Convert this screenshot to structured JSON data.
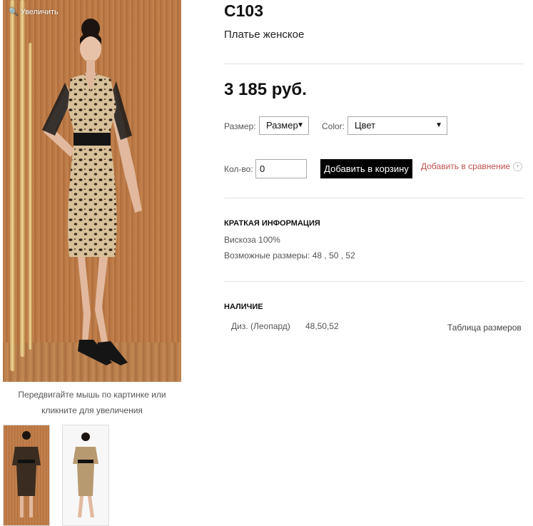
{
  "gallery": {
    "zoom_label": "Увеличить",
    "hint": "Передвигайте мышь по картинке или кликните для увеличения"
  },
  "product": {
    "sku": "С103",
    "subtitle": "Платье женское",
    "price": "3 185 руб."
  },
  "options": {
    "size_label": "Размер:",
    "size_value": "Размер",
    "color_label": "Color:",
    "color_value": "Цвет",
    "qty_label": "Кол-во:",
    "qty_value": "0",
    "add_to_cart": "Добавить в корзину",
    "add_to_compare": "Добавить в сравнение"
  },
  "short_info": {
    "title": "КРАТКАЯ ИНФОРМАЦИЯ",
    "material": "Вискоза 100%",
    "sizes": "Возможные размеры: 48 , 50 , 52"
  },
  "availability": {
    "title": "НАЛИЧИЕ",
    "color": "Диз. (Леопард)",
    "sizes": "48,50,52",
    "size_table_link": "Таблица размеров"
  },
  "colors": {
    "compare_link": "#c0504d",
    "button_bg": "#000000",
    "wood": "#b87745"
  }
}
